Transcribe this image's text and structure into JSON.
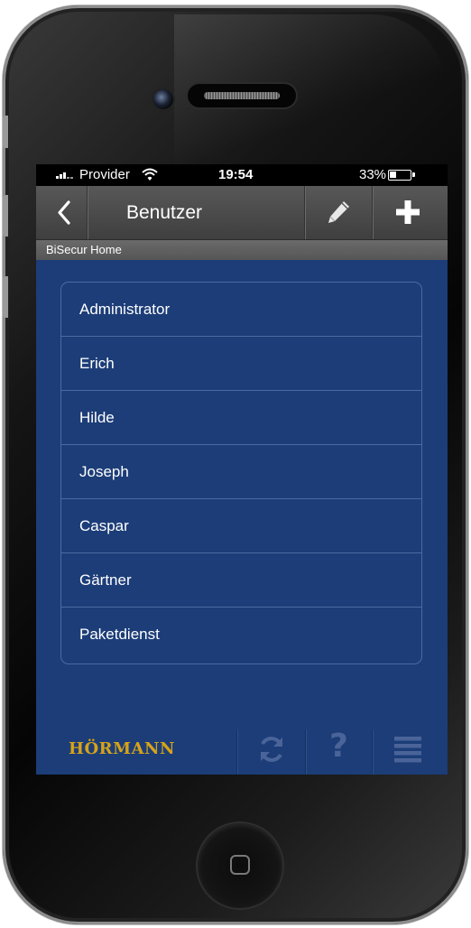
{
  "status_bar": {
    "carrier": "Provider",
    "time": "19:54",
    "battery_percent": "33%",
    "battery_level": 0.33,
    "wifi_icon": "wifi-icon",
    "signal_icon": "signal-icon"
  },
  "nav": {
    "title": "Benutzer",
    "back_icon": "chevron-left-icon",
    "edit_icon": "pencil-icon",
    "add_icon": "plus-icon"
  },
  "subheader": {
    "label": "BiSecur Home"
  },
  "users": [
    "Administrator",
    "Erich",
    "Hilde",
    "Joseph",
    "Caspar",
    "Gärtner",
    "Paketdienst"
  ],
  "footer": {
    "brand": "HÖRMANN",
    "refresh_icon": "refresh-icon",
    "help_icon": "help-icon",
    "help_glyph": "?",
    "menu_icon": "menu-icon"
  },
  "colors": {
    "screen_background": "#1c3d78",
    "brand_gold": "#d6a318",
    "nav_bar": "#4a4a4a",
    "inactive_icon": "#4a6499"
  }
}
